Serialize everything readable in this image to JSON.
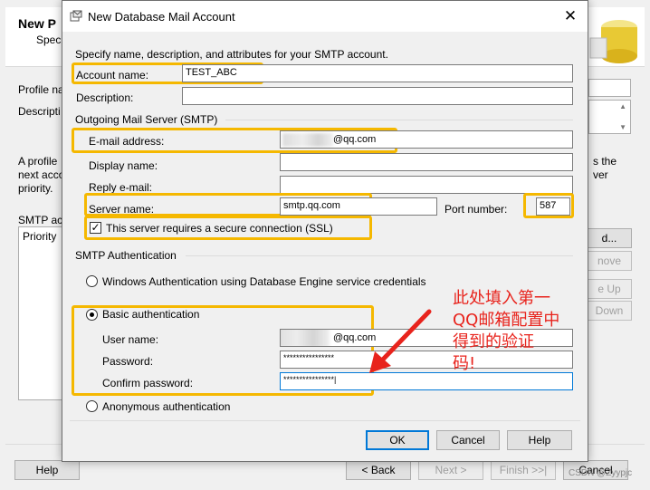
{
  "background": {
    "title": "New P",
    "subtitle": "Spec",
    "profile_name_label": "Profile na",
    "description_label": "Descripti",
    "para_line1": "A profile",
    "para_line2": "next acco",
    "para_line3": "priority.",
    "para_right1": "s the",
    "para_right2": "ver",
    "smtp_label": "SMTP ac",
    "priority_col": "Priority",
    "buttons": {
      "add": "d...",
      "remove": "nove",
      "move_up": "e Up",
      "move_down": "Down",
      "help": "Help",
      "back": "< Back",
      "next": "Next >",
      "finish": "Finish >>|",
      "cancel": "Cancel"
    }
  },
  "dialog": {
    "title": "New Database Mail Account",
    "instruction": "Specify name, description, and attributes for your SMTP account.",
    "account_name_label": "Account name:",
    "account_name_value": "TEST_ABC",
    "description_label": "Description:",
    "description_value": "",
    "outgoing_section": "Outgoing Mail Server (SMTP)",
    "email_label": "E-mail address:",
    "email_value": "@qq.com",
    "display_name_label": "Display name:",
    "display_name_value": "",
    "reply_label": "Reply e-mail:",
    "reply_value": "",
    "server_label": "Server name:",
    "server_value": "smtp.qq.com",
    "port_label": "Port number:",
    "port_value": "587",
    "ssl_label": "This server requires a secure connection (SSL)",
    "ssl_checked": true,
    "auth_section": "SMTP Authentication",
    "auth_windows": "Windows Authentication using Database Engine service credentials",
    "auth_basic": "Basic authentication",
    "username_label": "User name:",
    "username_value": "@qq.com",
    "password_label": "Password:",
    "password_value": "****************",
    "confirm_label": "Confirm password:",
    "confirm_value": "****************|",
    "auth_anonymous": "Anonymous authentication",
    "ok": "OK",
    "cancel": "Cancel",
    "help": "Help",
    "selected_auth": "basic"
  },
  "annotation": {
    "line1": "此处填入第一",
    "line2": "QQ邮箱配置中",
    "line3": "得到的验证",
    "line4": "码!",
    "color": "#e8231c"
  },
  "watermark": "CSDN @Zyypjc",
  "colors": {
    "highlight": "#f5b800",
    "focus_border": "#0078d7"
  },
  "icons": [
    "database-mail-icon",
    "close-icon",
    "checkbox-check-icon",
    "red-arrow",
    "database-logo"
  ]
}
